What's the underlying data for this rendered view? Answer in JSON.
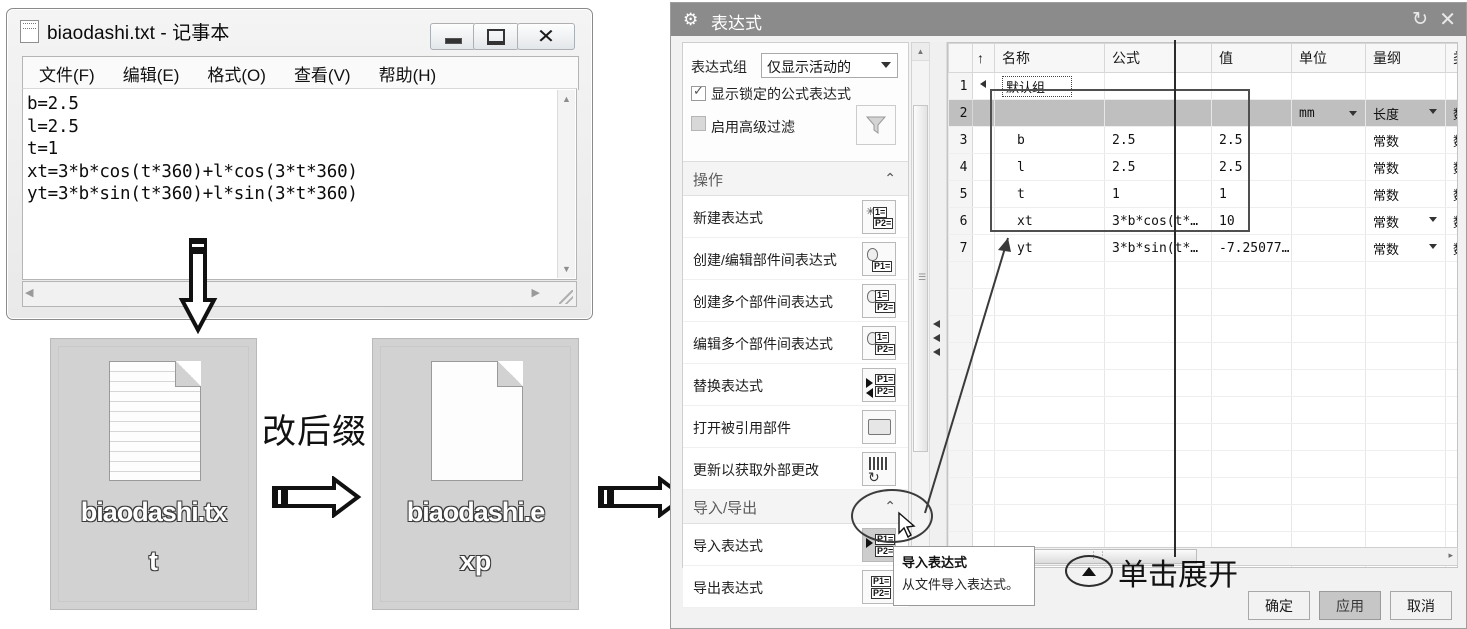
{
  "notepad": {
    "title": "biaodashi.txt - 记事本",
    "menus": [
      "文件(F)",
      "编辑(E)",
      "格式(O)",
      "查看(V)",
      "帮助(H)"
    ],
    "content": "b=2.5\nl=2.5\nt=1\nxt=3*b*cos(t*360)+l*cos(3*t*360)\nyt=3*b*sin(t*360)+l*sin(3*t*360)",
    "window_buttons": {
      "minimize": "minimize-icon",
      "maximize": "maximize-icon",
      "close": "close-icon"
    }
  },
  "desktop": {
    "file_before": {
      "name_line1": "biaodashi.tx",
      "name_line2": "t"
    },
    "file_after": {
      "name_line1": "biaodashi.e",
      "name_line2": "xp"
    },
    "annotation_rename": "改后缀"
  },
  "dialog": {
    "title": "表达式",
    "refresh_icon": "refresh-icon",
    "close_icon": "close-icon",
    "gear_icon": "gear-icon",
    "filters": {
      "group_label": "表达式组",
      "group_value": "仅显示活动的",
      "show_locked_label": "显示锁定的公式表达式",
      "show_locked_checked": true,
      "advanced_filter_label": "启用高级过滤",
      "advanced_filter_checked": false,
      "filter_icon": "funnel-icon"
    },
    "sections": [
      {
        "title": "操作",
        "collapse_icon": "chevron-up-icon",
        "items": [
          {
            "label": "新建表达式",
            "icon": "new-expression-icon"
          },
          {
            "label": "创建/编辑部件间表达式",
            "icon": "create-edit-interpart-icon"
          },
          {
            "label": "创建多个部件间表达式",
            "icon": "create-multi-interpart-icon"
          },
          {
            "label": "编辑多个部件间表达式",
            "icon": "edit-multi-interpart-icon"
          },
          {
            "label": "替换表达式",
            "icon": "replace-expression-icon"
          },
          {
            "label": "打开被引用部件",
            "icon": "open-referenced-part-icon"
          },
          {
            "label": "更新以获取外部更改",
            "icon": "update-external-changes-icon"
          }
        ]
      },
      {
        "title": "导入/导出",
        "collapse_icon": "chevron-up-icon",
        "items": [
          {
            "label": "导入表达式",
            "icon": "import-expression-icon"
          },
          {
            "label": "导出表达式",
            "icon": "export-expression-icon"
          }
        ]
      }
    ],
    "table": {
      "columns": [
        "名称",
        "公式",
        "值",
        "单位",
        "量纲",
        "类型"
      ],
      "sort_icon": "sort-ascending-icon",
      "rows": [
        {
          "n": "1",
          "group": true,
          "name": "默认组",
          "formula": "",
          "value": "",
          "unit": "",
          "dimension": "",
          "type": ""
        },
        {
          "n": "2",
          "group": false,
          "name": "",
          "formula": "",
          "value": "",
          "unit": "mm",
          "unit_dropdown": true,
          "dimension": "长度",
          "dimension_dropdown": true,
          "type": "数字",
          "highlight": true
        },
        {
          "n": "3",
          "group": false,
          "name": "b",
          "formula": "2.5",
          "value": "2.5",
          "unit": "",
          "dimension": "常数",
          "type": "数字"
        },
        {
          "n": "4",
          "group": false,
          "name": "l",
          "formula": "2.5",
          "value": "2.5",
          "unit": "",
          "dimension": "常数",
          "type": "数字"
        },
        {
          "n": "5",
          "group": false,
          "name": "t",
          "formula": "1",
          "value": "1",
          "unit": "",
          "dimension": "常数",
          "type": "数字"
        },
        {
          "n": "6",
          "group": false,
          "name": "xt",
          "formula": "3*b*cos(t*…",
          "value": "10",
          "unit": "",
          "dimension": "常数",
          "dimension_dropdown": true,
          "type": "数字"
        },
        {
          "n": "7",
          "group": false,
          "name": "yt",
          "formula": "3*b*sin(t*…",
          "value": "-7.25077…",
          "unit": "",
          "dimension": "常数",
          "dimension_dropdown": true,
          "type": "数字"
        }
      ]
    },
    "tooltip": {
      "title": "导入表达式",
      "body": "从文件导入表达式。"
    },
    "buttons": [
      {
        "label": "确定",
        "state": "normal"
      },
      {
        "label": "应用",
        "state": "active"
      },
      {
        "label": "取消",
        "state": "normal"
      }
    ]
  },
  "annotations": {
    "expand_hint": "单击展开"
  }
}
